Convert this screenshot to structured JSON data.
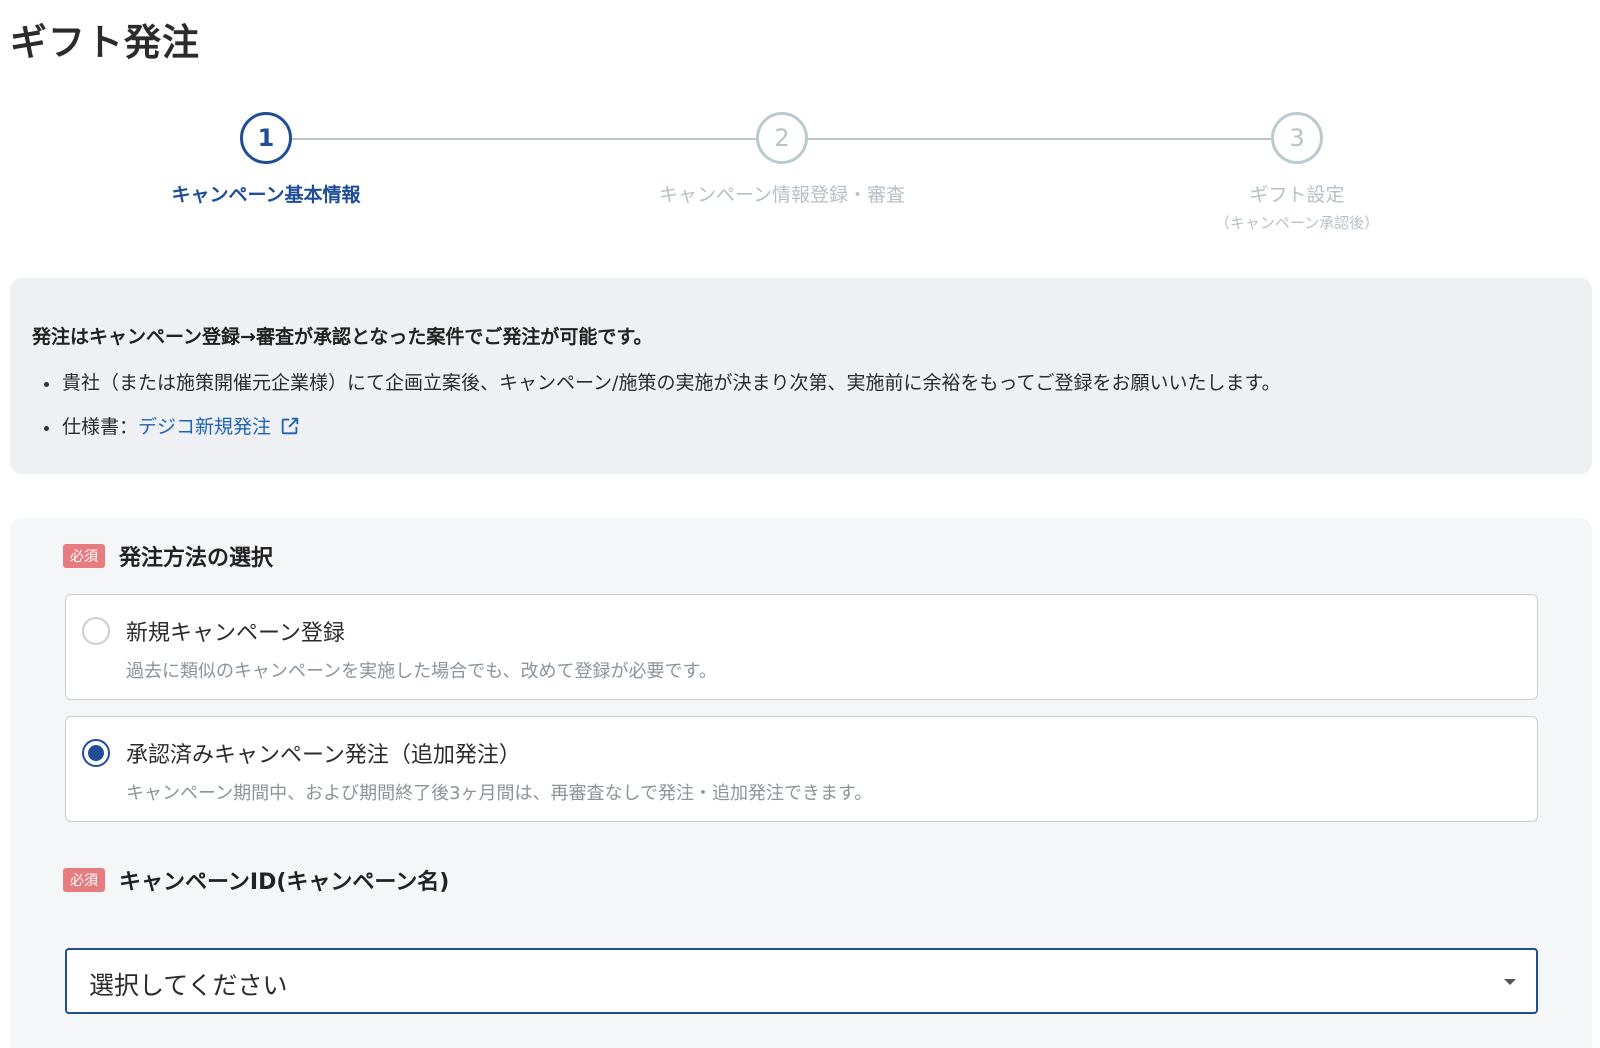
{
  "page": {
    "title": "ギフト発注"
  },
  "stepper": {
    "steps": [
      {
        "number": "1",
        "label": "キャンペーン基本情報",
        "sub": ""
      },
      {
        "number": "2",
        "label": "キャンペーン情報登録・審査",
        "sub": ""
      },
      {
        "number": "3",
        "label": "ギフト設定",
        "sub": "（キャンペーン承認後）"
      }
    ],
    "active_step": 1
  },
  "info": {
    "headline": "発注はキャンペーン登録→審査が承認となった案件でご発注が可能です。",
    "bullet1": "貴社（または施策開催元企業様）にて企画立案後、キャンペーン/施策の実施が決まり次第、実施前に余裕をもってご登録をお願いいたします。",
    "bullet2_prefix": "仕様書：",
    "bullet2_link": "デジコ新規発注",
    "link_icon": "external-link-icon"
  },
  "form": {
    "required_badge": "必須",
    "order_method": {
      "title": "発注方法の選択",
      "options": [
        {
          "title": "新規キャンペーン登録",
          "desc": "過去に類似のキャンペーンを実施した場合でも、改めて登録が必要です。",
          "checked": false
        },
        {
          "title": "承認済みキャンペーン発注（追加発注）",
          "desc": "キャンペーン期間中、および期間終了後3ヶ月間は、再審査なしで発注・追加発注できます。",
          "checked": true
        }
      ]
    },
    "campaign_id": {
      "title": "キャンペーンID(キャンペーン名)",
      "selected": "選択してください"
    }
  },
  "colors": {
    "accent": "#1f4e96",
    "link": "#1f63b0",
    "required_badge": "#e67c80",
    "inactive_step": "#b7c1c5"
  }
}
